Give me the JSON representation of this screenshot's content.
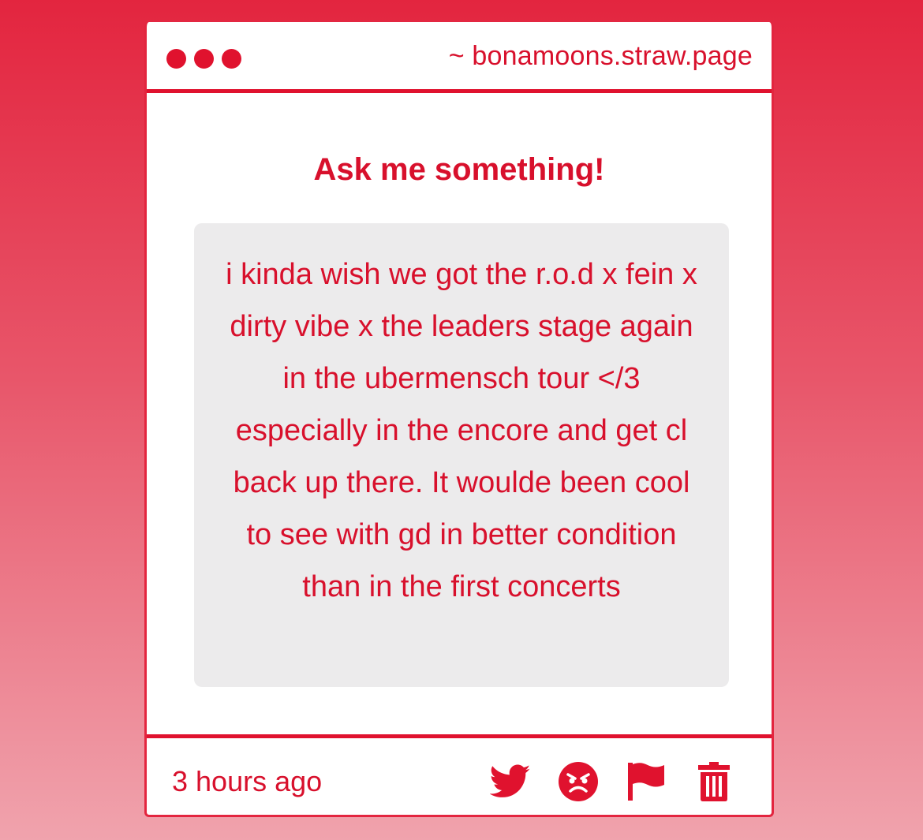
{
  "window": {
    "url": "~ bonamoons.straw.page"
  },
  "page": {
    "heading": "Ask me something!"
  },
  "question": {
    "text": "i kinda wish we got the r.o.d x fein x dirty vibe x the leaders stage again in the ubermensch tour </3 especially in the encore and get cl back up there. It woulde been cool to see with gd in better condition than in the first concerts"
  },
  "footer": {
    "timestamp": "3 hours ago",
    "actions": [
      {
        "icon": "twitter-icon"
      },
      {
        "icon": "angry-face-icon"
      },
      {
        "icon": "flag-icon"
      },
      {
        "icon": "trash-icon"
      }
    ]
  },
  "colors": {
    "accent": "#e0122e",
    "text": "#d8102c",
    "box_bg": "#ecebec"
  }
}
